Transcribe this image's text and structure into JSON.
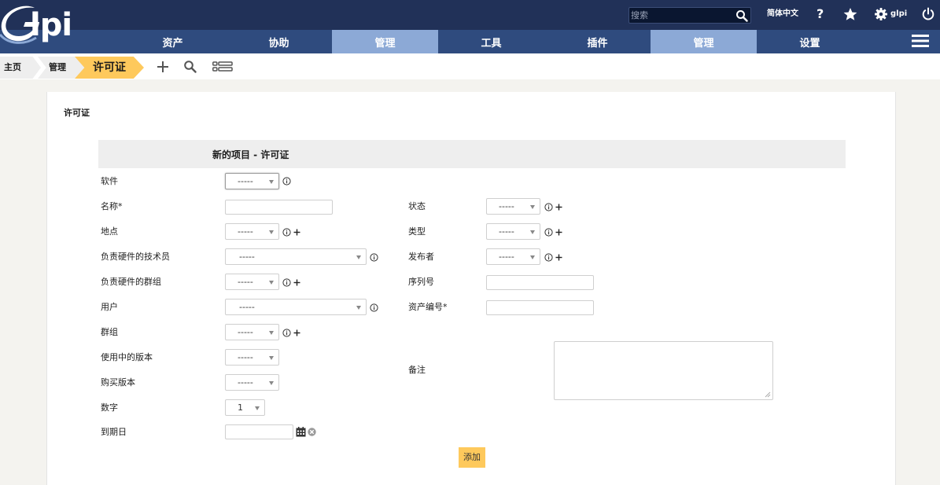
{
  "header": {
    "logo_text": "lpi",
    "search_placeholder": "搜索",
    "language": "简体中文",
    "help_label": "?",
    "user": "glpi"
  },
  "menu": {
    "items": [
      {
        "label": "资产",
        "active": false
      },
      {
        "label": "协助",
        "active": false
      },
      {
        "label": "管理",
        "active": true
      },
      {
        "label": "工具",
        "active": false
      },
      {
        "label": "插件",
        "active": false
      },
      {
        "label": "管理",
        "active": true
      },
      {
        "label": "设置",
        "active": false
      }
    ]
  },
  "breadcrumb": {
    "home": "主页",
    "section": "管理",
    "current": "许可证"
  },
  "panel": {
    "title": "许可证",
    "form_title": "新的项目 - 许可证"
  },
  "form": {
    "left": {
      "software": {
        "label": "软件",
        "value": "-----"
      },
      "name": {
        "label": "名称*",
        "value": ""
      },
      "location": {
        "label": "地点",
        "value": "-----"
      },
      "tech_user": {
        "label": "负责硬件的技术员",
        "value": "-----"
      },
      "tech_group": {
        "label": "负责硬件的群组",
        "value": "-----"
      },
      "user": {
        "label": "用户",
        "value": "-----"
      },
      "group": {
        "label": "群组",
        "value": "-----"
      },
      "version_in_use": {
        "label": "使用中的版本",
        "value": "-----"
      },
      "purchase_version": {
        "label": "购买版本",
        "value": "-----"
      },
      "number": {
        "label": "数字",
        "value": "1"
      },
      "expiry": {
        "label": "到期日",
        "value": ""
      }
    },
    "right": {
      "status": {
        "label": "状态",
        "value": "-----"
      },
      "type": {
        "label": "类型",
        "value": "-----"
      },
      "publisher": {
        "label": "发布者",
        "value": "-----"
      },
      "serial": {
        "label": "序列号",
        "value": ""
      },
      "inventory": {
        "label": "资产编号*",
        "value": ""
      },
      "notes": {
        "label": "备注",
        "value": ""
      }
    },
    "add_label": "添加"
  },
  "colors": {
    "topbar": "#213158",
    "menubar": "#2f4b7e",
    "menu_active": "#8ca9d6",
    "accent": "#fec95c"
  }
}
